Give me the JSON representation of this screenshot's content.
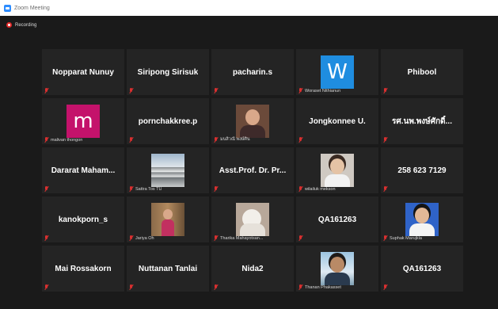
{
  "window": {
    "title": "Zoom Meeting"
  },
  "recording": {
    "label": "Recording",
    "color": "#e02828"
  },
  "tiles": [
    {
      "name": "Nopparat Nunuy",
      "label": ""
    },
    {
      "name": "Siripong Sirisuk",
      "label": ""
    },
    {
      "name": "pacharin.s",
      "label": ""
    },
    {
      "name": "",
      "label": "Woraset Nithianun",
      "avatar": "W",
      "avatar_color": "#1f8de0"
    },
    {
      "name": "Phibool",
      "label": ""
    },
    {
      "name": "",
      "label": "malivan thongon",
      "avatar": "m",
      "avatar_color": "#c4126b"
    },
    {
      "name": "pornchakkree.p",
      "label": ""
    },
    {
      "name": "",
      "label": "มนสิวณี พงษ์ศิน",
      "photo": "person-photo"
    },
    {
      "name": "Jongkonnee U.",
      "label": ""
    },
    {
      "name": "รศ.นพ.พงษ์ศักดิ์...",
      "label": ""
    },
    {
      "name": "Dararat Maham...",
      "label": ""
    },
    {
      "name": "",
      "label": "Sattra Tos TU",
      "photo": "building-photo"
    },
    {
      "name": "Asst.Prof. Dr. Pr...",
      "label": ""
    },
    {
      "name": "",
      "label": "wilailuk mekson",
      "photo": "person-photo"
    },
    {
      "name": "258 623 7129",
      "label": ""
    },
    {
      "name": "kanokporn_s",
      "label": ""
    },
    {
      "name": "",
      "label": "Jariya Oh",
      "photo": "person-photo"
    },
    {
      "name": "",
      "label": "Tharika Mahayotsan...",
      "photo": "cat-photo"
    },
    {
      "name": "QA161263",
      "label": ""
    },
    {
      "name": "",
      "label": "Suphak Marujkla",
      "photo": "person-photo"
    },
    {
      "name": "Mai Rossakorn",
      "label": ""
    },
    {
      "name": "Nuttanan Tanlai",
      "label": ""
    },
    {
      "name": "Nida2",
      "label": ""
    },
    {
      "name": "",
      "label": "Thanan Phakasset",
      "photo": "person-photo"
    },
    {
      "name": "QA161263",
      "label": ""
    }
  ]
}
